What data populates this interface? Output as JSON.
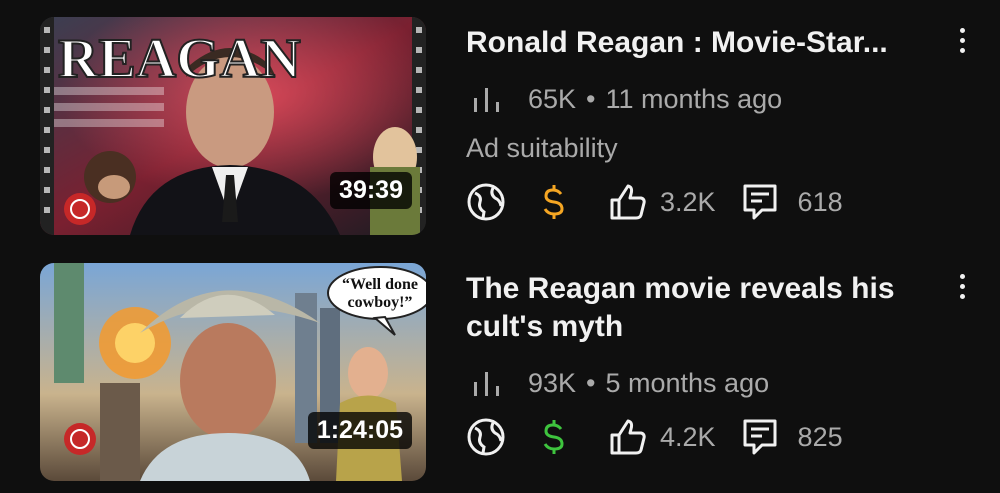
{
  "videos": [
    {
      "thumbnail_text": "REAGAN",
      "duration": "39:39",
      "title": "Ronald Reagan : Movie-Star...",
      "views": "65K",
      "separator": "•",
      "age": "11 months ago",
      "ad_suitability_label": "Ad suitability",
      "monetization_color": "#f5a623",
      "likes": "3.2K",
      "comments": "618"
    },
    {
      "thumbnail_text_line1": "“Well done",
      "thumbnail_text_line2": "cowboy!”",
      "duration": "1:24:05",
      "title": "The Reagan movie reveals his cult's myth",
      "views": "93K",
      "separator": "•",
      "age": "5 months ago",
      "monetization_color": "#3ec43e",
      "likes": "4.2K",
      "comments": "825"
    }
  ],
  "icons": {
    "views": "views-icon",
    "globe": "globe-icon",
    "monetization": "dollar-icon",
    "like": "thumbs-up-icon",
    "comment": "comment-icon",
    "more": "more-vert-icon"
  }
}
